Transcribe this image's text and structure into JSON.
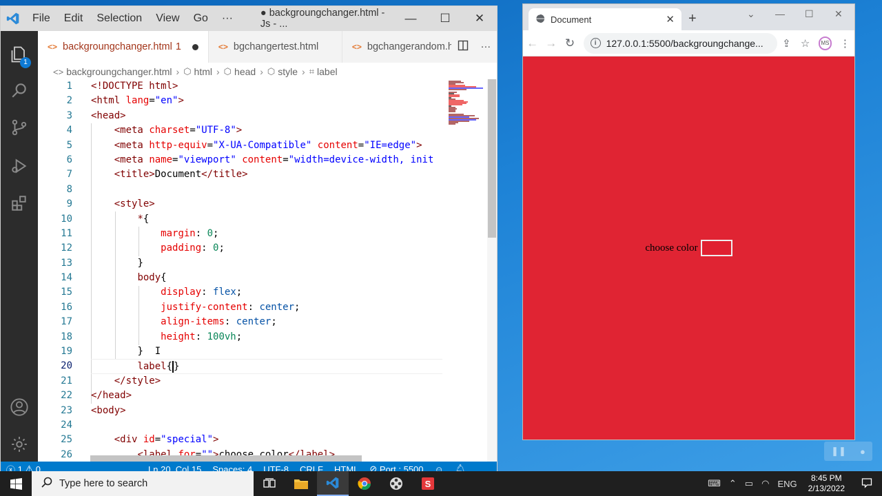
{
  "vscode": {
    "menu": [
      "File",
      "Edit",
      "Selection",
      "View",
      "Go",
      "···"
    ],
    "window_title": "● backgroungchanger.html - Js - ...",
    "activity_badge": "1",
    "tabs": [
      {
        "label": "backgroungchanger.html",
        "modified_count": "1",
        "active": true
      },
      {
        "label": "bgchangertest.html",
        "active": false
      },
      {
        "label": "bgchangerandom.h",
        "active": false
      }
    ],
    "breadcrumb": [
      "backgroungchanger.html",
      "html",
      "head",
      "style",
      "label"
    ],
    "line_numbers": [
      "1",
      "2",
      "3",
      "4",
      "5",
      "6",
      "7",
      "8",
      "9",
      "10",
      "11",
      "12",
      "13",
      "14",
      "15",
      "16",
      "17",
      "18",
      "19",
      "20",
      "21",
      "22",
      "23",
      "24",
      "25",
      "26"
    ],
    "current_line": "20",
    "status": {
      "errors": "1",
      "warnings": "0",
      "position": "Ln 20, Col 15",
      "spaces": "Spaces: 4",
      "encoding": "UTF-8",
      "eol": "CRLF",
      "language": "HTML",
      "port": "Port : 5500"
    }
  },
  "chrome": {
    "tab_title": "Document",
    "url": "127.0.0.1:5500/backgroungchange...",
    "page": {
      "label_text": "choose color",
      "background_color": "#e02433",
      "input_color": "#e02030"
    }
  },
  "taskbar": {
    "search_placeholder": "Type here to search",
    "language": "ENG",
    "time": "8:45 PM",
    "date": "2/13/2022"
  },
  "colors": {
    "vscode_statusbar": "#007acc",
    "activity_bar": "#2c2c2c",
    "desktop": "#1d82d6"
  }
}
